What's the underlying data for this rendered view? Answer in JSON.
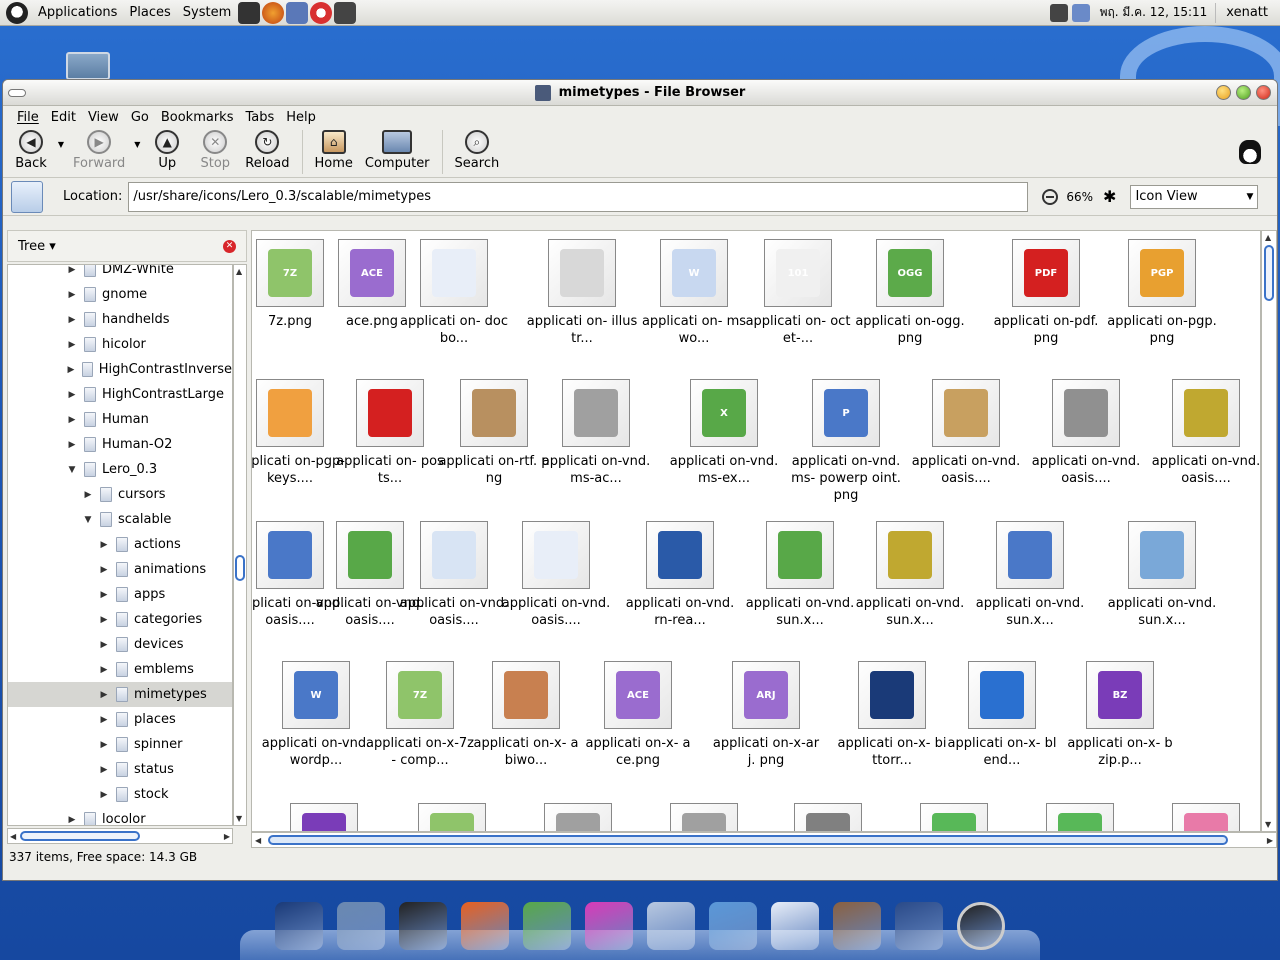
{
  "panel": {
    "menus": [
      "Applications",
      "Places",
      "System"
    ],
    "clock": "พฤ. มี.ค. 12, 15:11",
    "user": "xenatt"
  },
  "window": {
    "title": "mimetypes - File Browser"
  },
  "menubar": [
    "File",
    "Edit",
    "View",
    "Go",
    "Bookmarks",
    "Tabs",
    "Help"
  ],
  "toolbar": {
    "back": "Back",
    "forward": "Forward",
    "up": "Up",
    "stop": "Stop",
    "reload": "Reload",
    "home": "Home",
    "computer": "Computer",
    "search": "Search"
  },
  "location": {
    "label": "Location:",
    "value": "/usr/share/icons/Lero_0.3/scalable/mimetypes",
    "zoom": "66%",
    "view_mode": "Icon View"
  },
  "side": {
    "mode": "Tree",
    "rows": [
      {
        "label": "DMZ-White",
        "level": 1,
        "open": false,
        "selected": false
      },
      {
        "label": "gnome",
        "level": 1,
        "open": false,
        "selected": false
      },
      {
        "label": "handhelds",
        "level": 1,
        "open": false,
        "selected": false
      },
      {
        "label": "hicolor",
        "level": 1,
        "open": false,
        "selected": false
      },
      {
        "label": "HighContrastInverse",
        "level": 1,
        "open": false,
        "selected": false
      },
      {
        "label": "HighContrastLarge",
        "level": 1,
        "open": false,
        "selected": false
      },
      {
        "label": "Human",
        "level": 1,
        "open": false,
        "selected": false
      },
      {
        "label": "Human-O2",
        "level": 1,
        "open": false,
        "selected": false
      },
      {
        "label": "Lero_0.3",
        "level": 1,
        "open": true,
        "selected": false
      },
      {
        "label": "cursors",
        "level": 2,
        "open": false,
        "selected": false
      },
      {
        "label": "scalable",
        "level": 2,
        "open": true,
        "selected": false
      },
      {
        "label": "actions",
        "level": 3,
        "open": false,
        "selected": false
      },
      {
        "label": "animations",
        "level": 3,
        "open": false,
        "selected": false
      },
      {
        "label": "apps",
        "level": 3,
        "open": false,
        "selected": false
      },
      {
        "label": "categories",
        "level": 3,
        "open": false,
        "selected": false
      },
      {
        "label": "devices",
        "level": 3,
        "open": false,
        "selected": false
      },
      {
        "label": "emblems",
        "level": 3,
        "open": false,
        "selected": false
      },
      {
        "label": "mimetypes",
        "level": 3,
        "open": false,
        "selected": true
      },
      {
        "label": "places",
        "level": 3,
        "open": false,
        "selected": false
      },
      {
        "label": "spinner",
        "level": 3,
        "open": false,
        "selected": false
      },
      {
        "label": "status",
        "level": 3,
        "open": false,
        "selected": false
      },
      {
        "label": "stock",
        "level": 3,
        "open": false,
        "selected": false
      },
      {
        "label": "locolor",
        "level": 1,
        "open": false,
        "selected": false
      }
    ]
  },
  "files": [
    {
      "name": "7z.png",
      "color": "#8fc46a",
      "badge": "7Z"
    },
    {
      "name": "ace.png",
      "color": "#9a6ccf",
      "badge": "ACE"
    },
    {
      "name": "applicati on- docbo...",
      "color": "#e8eef8",
      "badge": ""
    },
    {
      "name": "applicati on- illustr...",
      "color": "#d8d8d8",
      "badge": ""
    },
    {
      "name": "applicati on- mswo...",
      "color": "#c8d8f0",
      "badge": "W"
    },
    {
      "name": "applicati on- octet-...",
      "color": "#f0f0f0",
      "badge": "101"
    },
    {
      "name": "applicati on-ogg. png",
      "color": "#5caa4a",
      "badge": "OGG"
    },
    {
      "name": "applicati on-pdf. png",
      "color": "#d42020",
      "badge": "PDF"
    },
    {
      "name": "applicati on-pgp. png",
      "color": "#e8a030",
      "badge": "PGP"
    },
    {
      "name": "applicati on-pgp- keys....",
      "color": "#f0a040",
      "badge": ""
    },
    {
      "name": "applicati on- posts...",
      "color": "#d42020",
      "badge": ""
    },
    {
      "name": "applicati on-rtf. png",
      "color": "#b89060",
      "badge": ""
    },
    {
      "name": "applicati on-vnd. ms-ac...",
      "color": "#a0a0a0",
      "badge": ""
    },
    {
      "name": "applicati on-vnd. ms-ex...",
      "color": "#58a848",
      "badge": "X"
    },
    {
      "name": "applicati on-vnd. ms- powerp oint.png",
      "color": "#4a78c8",
      "badge": "P"
    },
    {
      "name": "applicati on-vnd. oasis....",
      "color": "#c8a060",
      "badge": ""
    },
    {
      "name": "applicati on-vnd. oasis....",
      "color": "#909090",
      "badge": ""
    },
    {
      "name": "applicati on-vnd. oasis....",
      "color": "#c0a830",
      "badge": ""
    },
    {
      "name": "applicati on-vnd. oasis....",
      "color": "#4a78c8",
      "badge": ""
    },
    {
      "name": "applicati on-vnd. oasis....",
      "color": "#58a848",
      "badge": ""
    },
    {
      "name": "applicati on-vnd. oasis....",
      "color": "#d8e4f4",
      "badge": ""
    },
    {
      "name": "applicati on-vnd. oasis....",
      "color": "#e8eef8",
      "badge": ""
    },
    {
      "name": "applicati on-vnd. rn-rea...",
      "color": "#2a5aa8",
      "badge": ""
    },
    {
      "name": "applicati on-vnd. sun.x...",
      "color": "#58a848",
      "badge": ""
    },
    {
      "name": "applicati on-vnd. sun.x...",
      "color": "#c0a830",
      "badge": ""
    },
    {
      "name": "applicati on-vnd. sun.x...",
      "color": "#4a78c8",
      "badge": ""
    },
    {
      "name": "applicati on-vnd. sun.x...",
      "color": "#7aa8d8",
      "badge": ""
    },
    {
      "name": "applicati on-vnd. wordp...",
      "color": "#4a78c8",
      "badge": "W"
    },
    {
      "name": "applicati on-x-7z- comp...",
      "color": "#8fc46a",
      "badge": "7Z"
    },
    {
      "name": "applicati on-x- abiwo...",
      "color": "#c88050",
      "badge": ""
    },
    {
      "name": "applicati on-x- ace.png",
      "color": "#9a6ccf",
      "badge": "ACE"
    },
    {
      "name": "applicati on-x-arj. png",
      "color": "#9a6ccf",
      "badge": "ARJ"
    },
    {
      "name": "applicati on-x- bittorr...",
      "color": "#1a3a78",
      "badge": ""
    },
    {
      "name": "applicati on-x- blend...",
      "color": "#2a70d0",
      "badge": ""
    },
    {
      "name": "applicati on-x- bzip.p...",
      "color": "#7a3cb8",
      "badge": "BZ"
    }
  ],
  "partial_row_colors": [
    "#7a3cb8",
    "#8fc46a",
    "#a0a0a0",
    "#a0a0a0",
    "#808080",
    "#58b858",
    "#58b858",
    "#e87aa8"
  ],
  "status": "337 items, Free space: 14.3 GB",
  "dock": [
    "windows-logo-icon",
    "file-manager-icon",
    "terminal-icon",
    "firefox-icon",
    "pidgin-icon",
    "flower-icon",
    "itunes-icon",
    "drawer-icon",
    "network-icon",
    "image-viewer-icon",
    "calendar-icon",
    "power-icon"
  ]
}
